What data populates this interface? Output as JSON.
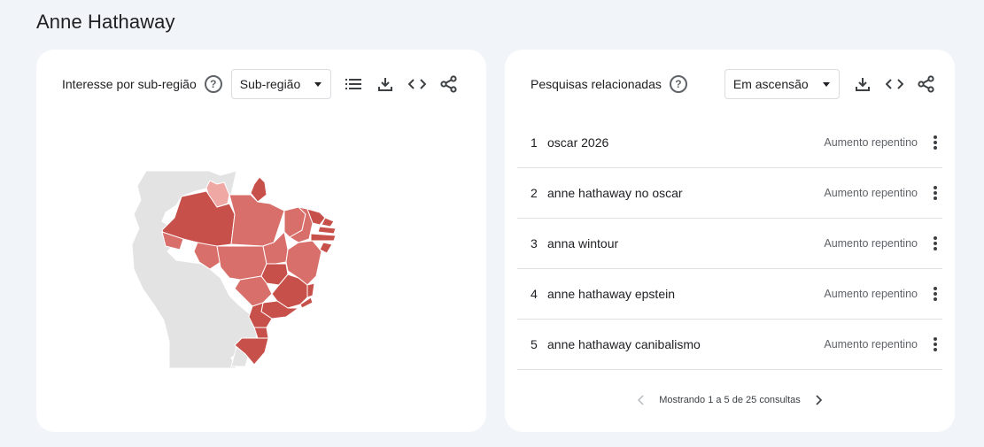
{
  "page": {
    "title": "Anne Hathaway"
  },
  "region_card": {
    "title": "Interesse por sub-região",
    "select_value": "Sub-região"
  },
  "related_card": {
    "title": "Pesquisas relacionadas",
    "select_value": "Em ascensão",
    "rows": [
      {
        "rank": "1",
        "query": "oscar 2026",
        "status": "Aumento repentino"
      },
      {
        "rank": "2",
        "query": "anne hathaway no oscar",
        "status": "Aumento repentino"
      },
      {
        "rank": "3",
        "query": "anna wintour",
        "status": "Aumento repentino"
      },
      {
        "rank": "4",
        "query": "anne hathaway epstein",
        "status": "Aumento repentino"
      },
      {
        "rank": "5",
        "query": "anne hathaway canibalismo",
        "status": "Aumento repentino"
      }
    ],
    "pagination": "Mostrando 1 a 5 de 25 consultas"
  },
  "colors": {
    "map_dark": "#c8504a",
    "map_mid": "#d86f6a",
    "map_light": "#efa8a3",
    "map_neighbor": "#e3e3e3"
  },
  "icons": [
    "help-icon",
    "list-icon",
    "download-icon",
    "embed-icon",
    "share-icon",
    "more-vert-icon",
    "chevron-left-icon",
    "chevron-right-icon"
  ]
}
